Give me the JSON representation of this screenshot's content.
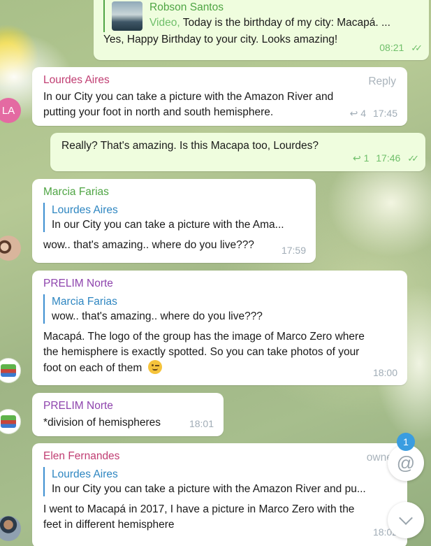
{
  "messages": {
    "m1": {
      "reply_name": "Robson Santos",
      "reply_prefix": "Video,",
      "reply_text": "Today is the birthday of my city: Macapá. ...",
      "text": "Yes, Happy Birthday to your city. Looks amazing!",
      "time": "08:21"
    },
    "m2": {
      "sender": "Lourdes Aires",
      "action": "Reply",
      "text1": "In our City you can take a picture with the Amazon River and",
      "text2": "putting your foot in north and south hemisphere.",
      "reply_count": "4",
      "time": "17:45",
      "avatar": "LA"
    },
    "m3": {
      "text": "Really? That's amazing. Is this Macapa too, Lourdes?",
      "reply_count": "1",
      "time": "17:46"
    },
    "m4": {
      "sender": "Marcia Farias",
      "reply_name": "Lourdes Aires",
      "reply_text": "In our City you can take a picture with the Ama...",
      "text": "wow.. that's amazing.. where do you live???",
      "time": "17:59"
    },
    "m5": {
      "sender": "PRELIM Norte",
      "reply_name": "Marcia Farias",
      "reply_text": "wow.. that's amazing.. where do you live???",
      "text1": "Macapá. The logo of the group has the image of Marco Zero where",
      "text2": "the hemisphere is exactly spotted. So you can take photos of your",
      "text3": "foot on each of them",
      "time": "18:00"
    },
    "m6": {
      "sender": "PRELIM Norte",
      "text": "*division of hemispheres",
      "time": "18:01"
    },
    "m7": {
      "sender": "Elen Fernandes",
      "role": "owner",
      "reply_name": "Lourdes Aires",
      "reply_text": "In our City you can take a picture with the Amazon River and pu...",
      "text1": "I went to Macapá in 2017, I have a picture in Marco Zero with the",
      "text2": "feet in  different hemisphere",
      "time": "18:02"
    }
  },
  "mentions_badge": "1",
  "colors": {
    "out_bubble": "#effdde",
    "in_bubble": "#ffffff",
    "sender_lourdes": "#c03d72",
    "sender_marcia": "#4fa544",
    "sender_prelim": "#8e44ad",
    "sender_elen": "#c03d72",
    "reply_bar": "#3d8fd1",
    "badge": "#3a9de0"
  }
}
